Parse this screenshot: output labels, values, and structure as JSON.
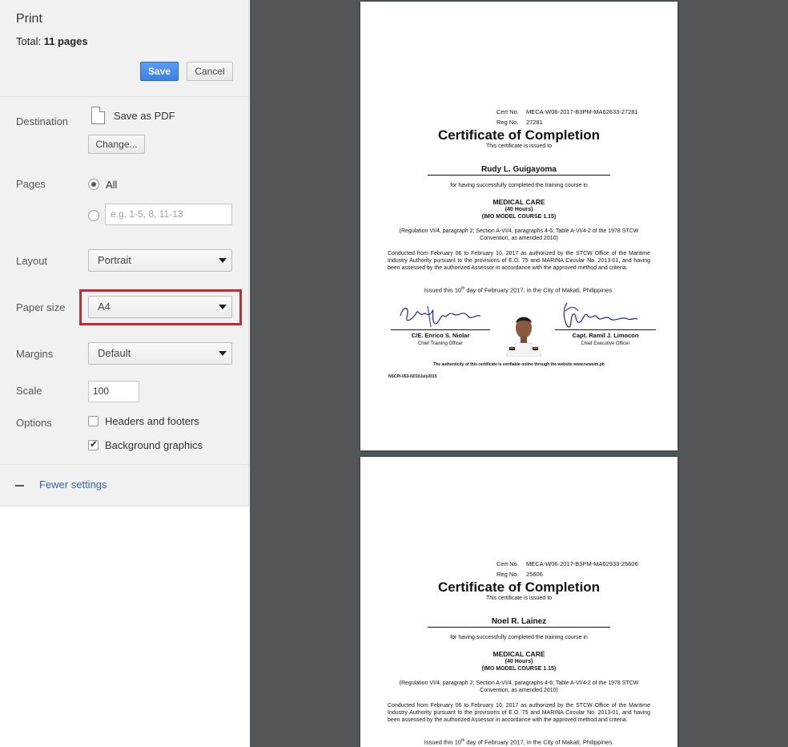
{
  "print_dialog": {
    "title": "Print",
    "total_label": "Total:",
    "total_value": "11 pages",
    "save_label": "Save",
    "cancel_label": "Cancel"
  },
  "destination": {
    "label": "Destination",
    "name": "Save as PDF",
    "change_label": "Change..."
  },
  "pages": {
    "label": "Pages",
    "all_label": "All",
    "selected": "All",
    "range_placeholder": "e.g. 1-5, 8, 11-13"
  },
  "layout": {
    "label": "Layout",
    "value": "Portrait"
  },
  "paper_size": {
    "label": "Paper size",
    "value": "A4",
    "highlight_color": "#d0232d"
  },
  "margins": {
    "label": "Margins",
    "value": "Default"
  },
  "scale": {
    "label": "Scale",
    "value": "100"
  },
  "options": {
    "label": "Options",
    "headers_footers": {
      "label": "Headers and footers",
      "checked": false
    },
    "background_graphics": {
      "label": "Background graphics",
      "checked": true
    }
  },
  "fewer_settings_label": "Fewer settings",
  "preview": {
    "background_color": "#525659",
    "pages": [
      {
        "cert_no_label": "Cert No.",
        "cert_no": "MECA-W06-2017-B3PM-MA62633-27281",
        "reg_no_label": "Reg No.",
        "reg_no": "27281",
        "title": "Certificate of Completion",
        "issued_to": "This certificate is issued to",
        "name": "Rudy L. Guigayoma",
        "completed_text": "for having successfully completed the training course in",
        "course": "MEDICAL CARE",
        "hours": "(40 Hours)",
        "model_course": "(IMO MODEL COURSE 1.15)",
        "regulation": "(Regulation VI/4, paragraph 2; Section A-VI/4, paragraphs 4-6; Table A-VI/4-2 of the 1978 STCW Convention, as amended 2010)",
        "conducted": "Conducted from February 06 to February 10, 2017 as authorized by the STCW Office of the Maritime Industry Authority pursuant to the provisions of E.O. 75 and MARINA Circular No. 2013-01, and having been assessed by the authorized Assessor in accordance with the approved method and criteria.",
        "issued_prefix": "Issued this 10",
        "issued_sup": "th",
        "issued_suffix": " day of February 2017, in the City of Makati, Philippines.",
        "sig_left_name": "C/E. Enrico S. Niolar",
        "sig_left_title": "Chief Training Officer",
        "sig_right_name": "Capt. Ramil J. Limocon",
        "sig_right_title": "Chief Executive Officer",
        "verify": "The authenticity of this certificate is verifiable online through the website www.newsim.ph",
        "form_code": "NSCPI-053-02/10July2015"
      },
      {
        "cert_no_label": "Cert No.",
        "cert_no": "MECA-W06-2017-B3PM-MA62933-25606",
        "reg_no_label": "Reg No.",
        "reg_no": "25606",
        "title": "Certificate of Completion",
        "issued_to": "This certificate is issued to",
        "name": "Noel R. Lainez",
        "completed_text": "for having successfully completed the training course in",
        "course": "MEDICAL CARE",
        "hours": "(40 Hours)",
        "model_course": "(IMO MODEL COURSE 1.15)",
        "regulation": "(Regulation VI/4, paragraph 2; Section A-VI/4, paragraphs 4-6; Table A-VI/4-2 of the 1978 STCW Convention, as amended 2010)",
        "conducted": "Conducted from February 06 to February 10, 2017 as authorized by the STCW Office of the Maritime Industry Authority pursuant to the provisions of E.O. 75 and MARINA Circular No. 2013-01, and having been assessed by the authorized Assessor in accordance with the approved method and criteria.",
        "issued_prefix": "Issued this 10",
        "issued_sup": "th",
        "issued_suffix": " day of February 2017, in the City of Makati, Philippines."
      }
    ]
  }
}
